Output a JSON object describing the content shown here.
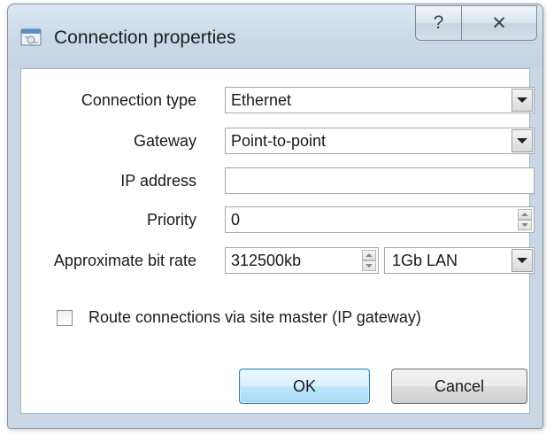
{
  "window": {
    "title": "Connection properties",
    "help_glyph": "?",
    "close_glyph": "✕"
  },
  "form": {
    "connection_type": {
      "label": "Connection type",
      "value": "Ethernet"
    },
    "gateway": {
      "label": "Gateway",
      "value": "Point-to-point"
    },
    "ip_address": {
      "label": "IP address",
      "value": ""
    },
    "priority": {
      "label": "Priority",
      "value": "0"
    },
    "bit_rate": {
      "label": "Approximate bit rate",
      "value": "312500kb",
      "preset": "1Gb LAN"
    }
  },
  "route_checkbox": {
    "label": "Route connections via site master (IP gateway)",
    "checked": false
  },
  "buttons": {
    "ok": "OK",
    "cancel": "Cancel"
  },
  "icons": {
    "app": "network-properties-icon",
    "help": "help-icon",
    "close": "close-icon",
    "dropdown": "chevron-down-icon",
    "spinner": "spinner-arrows-icon"
  },
  "colors": {
    "title_bar": "#c9d6e3",
    "ok_accent": "#3c7fb1"
  }
}
